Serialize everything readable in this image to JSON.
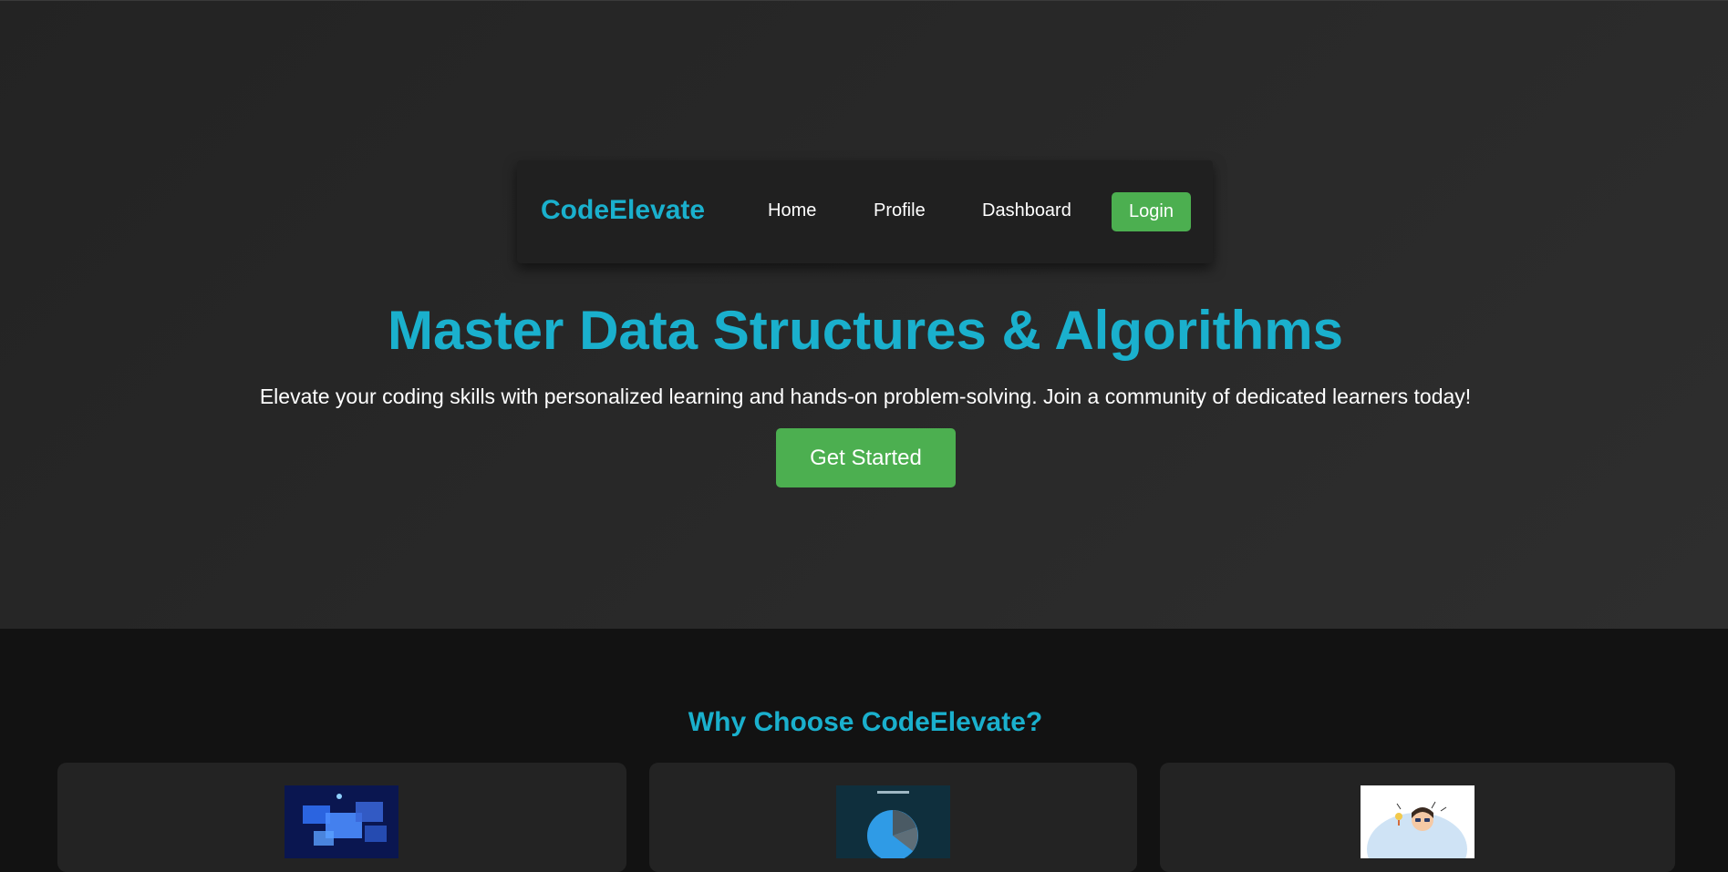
{
  "nav": {
    "brand": "CodeElevate",
    "links": [
      {
        "label": "Home"
      },
      {
        "label": "Profile"
      },
      {
        "label": "Dashboard"
      }
    ],
    "login_label": "Login"
  },
  "hero": {
    "title": "Master Data Structures & Algorithms",
    "subtitle": "Elevate your coding skills with personalized learning and hands-on problem-solving. Join a community of dedicated learners today!",
    "cta_label": "Get Started"
  },
  "features": {
    "title": "Why Choose CodeElevate?",
    "cards": [
      {
        "icon": "dashboard-screens-image"
      },
      {
        "icon": "pie-chart-image"
      },
      {
        "icon": "idea-person-image"
      }
    ]
  },
  "colors": {
    "accent": "#1ab0cd",
    "button": "#4caf50",
    "background": "#121212"
  }
}
